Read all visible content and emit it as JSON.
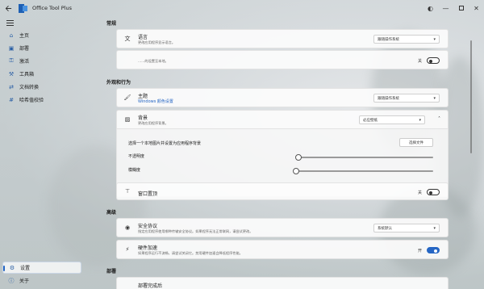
{
  "window": {
    "title": "Office Tool Plus"
  },
  "sidebar": {
    "items": [
      {
        "label": "主页",
        "icon": "home-icon"
      },
      {
        "label": "部署",
        "icon": "deploy-icon"
      },
      {
        "label": "激活",
        "icon": "key-icon"
      },
      {
        "label": "工具箱",
        "icon": "toolbox-icon"
      },
      {
        "label": "文档转换",
        "icon": "convert-icon"
      },
      {
        "label": "哈希值校验",
        "icon": "hash-icon"
      }
    ],
    "settings_label": "设置",
    "about_label": "关于"
  },
  "sections": {
    "general": "常规",
    "appearance": "外观和行为",
    "advanced": "高级",
    "deploy": "部署"
  },
  "cards": {
    "language": {
      "title": "语言",
      "desc": "更改应用程序显示语言。",
      "value": "跟随操作系统"
    },
    "blank": {
      "desc": "……的设置至本地。",
      "toggle_label": "关"
    },
    "theme": {
      "title": "主题",
      "link": "Windows 颜色设置",
      "value": "跟随操作系统"
    },
    "background": {
      "title": "背景",
      "desc": "更改应用程序背景。",
      "value": "必应壁纸"
    },
    "background_sub": {
      "choose_label": "选择一个本地图片并设置为应用程序背景",
      "choose_button": "选择文件",
      "opacity_label": "不透明度",
      "blur_label": "模糊度",
      "opacity_value": 0.02,
      "blur_value": 0
    },
    "pin": {
      "title": "窗口置顶",
      "toggle_label": "关"
    },
    "security": {
      "title": "安全协议",
      "desc": "指定应用程序使用哪种传输安全协议。如果程序无法正常联网，请尝试更改。",
      "value": "系统默认"
    },
    "hw_accel": {
      "title": "硬件加速",
      "desc": "如果程序运行不流畅，请尝试关闭它。禁用硬件加速会降低程序性能。",
      "toggle_label": "开"
    },
    "deploy_done": {
      "title": "部署完成后"
    }
  }
}
